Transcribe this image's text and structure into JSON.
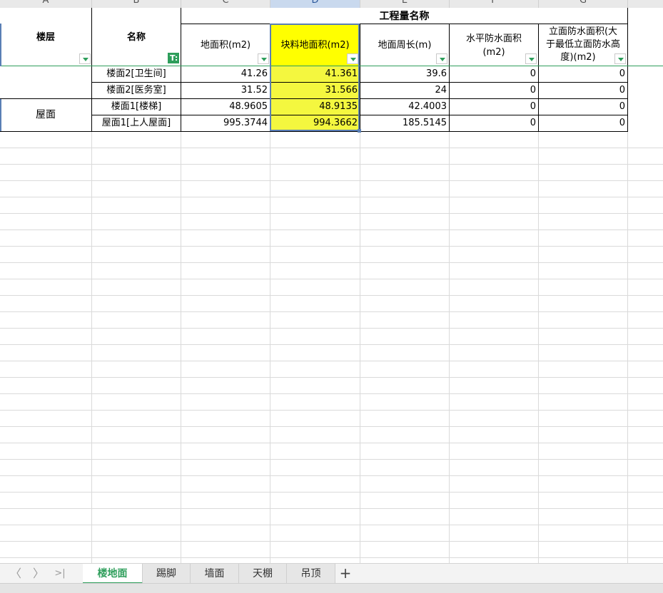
{
  "columns": [
    "A",
    "B",
    "C",
    "D",
    "E",
    "F",
    "G"
  ],
  "header": {
    "floor": "楼层",
    "name": "名称",
    "group_title": "工程量名称",
    "ground_area": "地面积(m2)",
    "block_area": "块料地面积(m2)",
    "perimeter": "地面周长(m)",
    "horiz_waterproof_l1": "水平防水面积",
    "horiz_waterproof_l2": "(m2)",
    "vert_waterproof_l1": "立面防水面积(大",
    "vert_waterproof_l2": "于最低立面防水高",
    "vert_waterproof_l3": "度)(m2)"
  },
  "rows": [
    {
      "floor": "",
      "name": "楼面2[卫生间]",
      "ground_area": "41.26",
      "block_area": "41.361",
      "perimeter": "39.6",
      "horiz": "0",
      "vert": "0"
    },
    {
      "floor": "",
      "name": "楼面2[医务室]",
      "ground_area": "31.52",
      "block_area": "31.566",
      "perimeter": "24",
      "horiz": "0",
      "vert": "0"
    },
    {
      "floor": "屋面",
      "name": "楼面1[楼梯]",
      "ground_area": "48.9605",
      "block_area": "48.9135",
      "perimeter": "42.4003",
      "horiz": "0",
      "vert": "0"
    },
    {
      "floor": "",
      "name": "屋面1[上人屋面]",
      "ground_area": "995.3744",
      "block_area": "994.3662",
      "perimeter": "185.5145",
      "horiz": "0",
      "vert": "0"
    }
  ],
  "tabs": [
    "楼地面",
    "踢脚",
    "墙面",
    "天棚",
    "吊顶"
  ],
  "active_tab": "楼地面",
  "add_tab_label": "+",
  "nav_icons": {
    "prev": "〈",
    "next": "〉",
    "last": ">|"
  },
  "filter_icon_label": "T:",
  "colors": {
    "accent": "#2e9e5b",
    "highlight_header": "#ffff00",
    "highlight_cells": "#f4f73f",
    "selection_border": "#5a7fb5"
  }
}
